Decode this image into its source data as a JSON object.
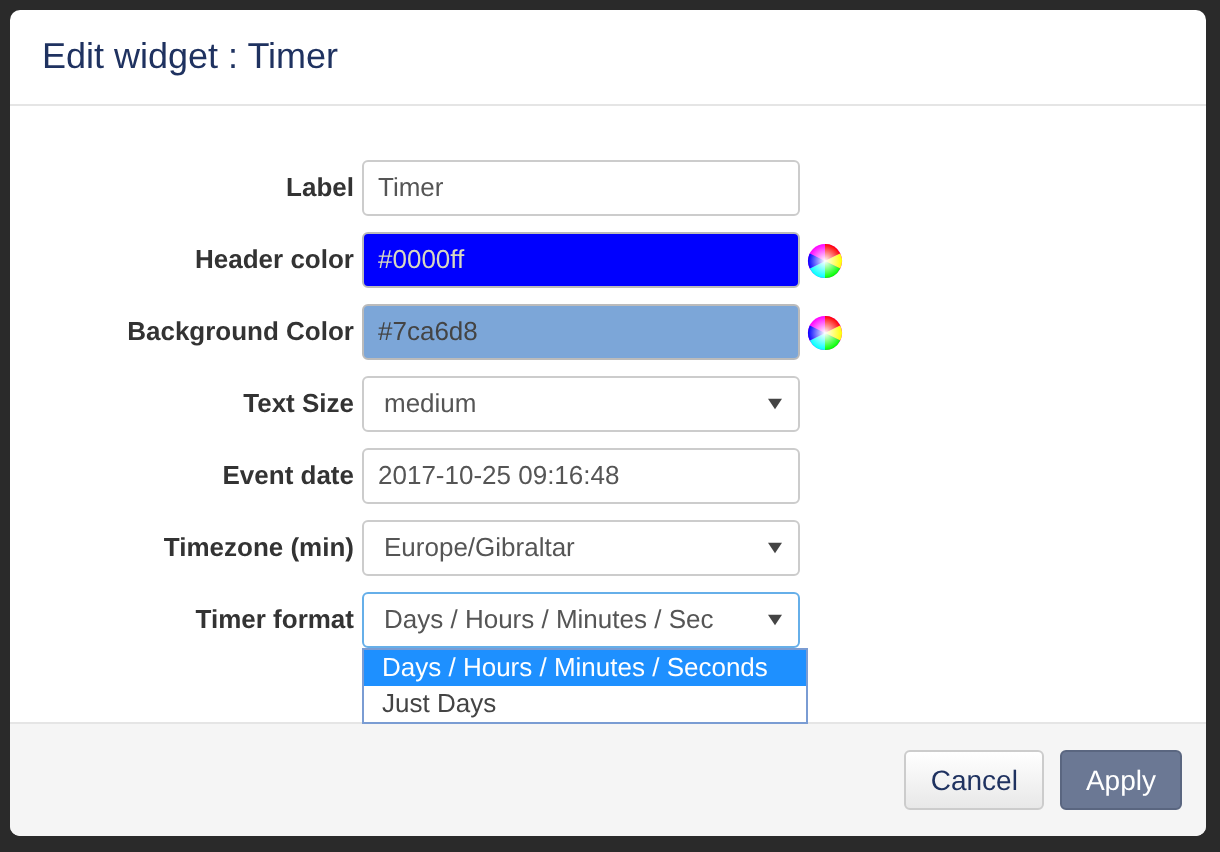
{
  "dialog": {
    "title": "Edit widget : Timer"
  },
  "fields": [
    {
      "label": "Label",
      "kind": "text",
      "value": "Timer"
    },
    {
      "label": "Header color",
      "kind": "color",
      "value": "#0000ff",
      "color": "#0000ff"
    },
    {
      "label": "Background Color",
      "kind": "color",
      "value": "#7ca6d8",
      "color": "#7ca6d8"
    },
    {
      "label": "Text Size",
      "kind": "select",
      "value": "medium"
    },
    {
      "label": "Event date",
      "kind": "text",
      "value": "2017-10-25 09:16:48"
    },
    {
      "label": "Timezone (min)",
      "kind": "select",
      "value": "Europe/Gibraltar"
    },
    {
      "label": "Timer format",
      "kind": "select",
      "value": "Days / Hours / Minutes / Sec",
      "expanded": true,
      "options": [
        {
          "label": "Days / Hours / Minutes / Seconds",
          "selected": true
        },
        {
          "label": "Just Days",
          "selected": false
        }
      ]
    }
  ],
  "buttons": [
    {
      "label": "Cancel",
      "kind": "default"
    },
    {
      "label": "Apply",
      "kind": "primary"
    }
  ]
}
